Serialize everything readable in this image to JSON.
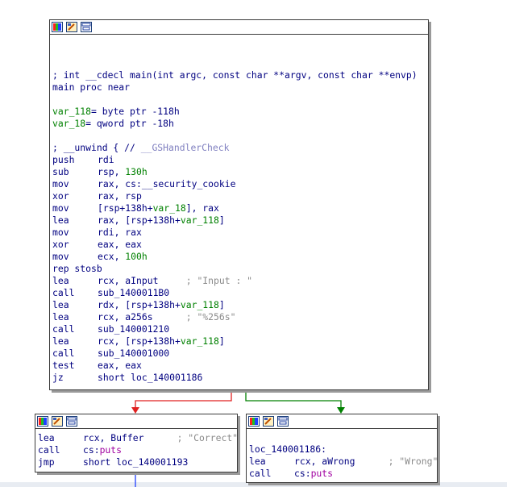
{
  "toolbar_icons": [
    "graph-color-icon",
    "edit-node-icon",
    "group-nodes-icon"
  ],
  "colors": {
    "edge_false": "#e02020",
    "edge_true": "#008000",
    "edge_uncond": "#2040ff",
    "text": "#000080",
    "number": "#008000",
    "comment": "#8a8a8a",
    "import": "#a000a0"
  },
  "main_block": {
    "header_comment": "; int __cdecl main(int argc, const char **argv, const char **envp)",
    "proc": "main proc near",
    "var1": {
      "name": "var_118",
      "def": "= byte ptr -118h"
    },
    "var2": {
      "name": "var_18",
      "def": "= qword ptr -18h"
    },
    "unwind": {
      "prefix": "; __unwind { // ",
      "handler": "__GSHandlerCheck"
    },
    "instructions": [
      {
        "mn": "push",
        "ops": "rdi"
      },
      {
        "mn": "sub",
        "ops": "rsp, ",
        "num": "130h"
      },
      {
        "mn": "mov",
        "ops": "rax, cs:__security_cookie"
      },
      {
        "mn": "xor",
        "ops": "rax, rsp"
      },
      {
        "mn": "mov",
        "pre": "[rsp+138h+",
        "var": "var_18",
        "post": "], rax"
      },
      {
        "mn": "lea",
        "pre": "rax, [rsp+138h+",
        "var": "var_118",
        "post": "]"
      },
      {
        "mn": "mov",
        "ops": "rdi, rax"
      },
      {
        "mn": "xor",
        "ops": "eax, eax"
      },
      {
        "mn": "mov",
        "ops": "ecx, ",
        "num": "100h"
      }
    ],
    "rep": "rep stosb",
    "instructions2": [
      {
        "mn": "lea",
        "ops": "rcx, aInput     ",
        "cmt": "; \"Input : \""
      },
      {
        "mn": "call",
        "ops": "sub_1400011B0"
      },
      {
        "mn": "lea",
        "pre": "rdx, [rsp+138h+",
        "var": "var_118",
        "post": "]"
      },
      {
        "mn": "lea",
        "ops": "rcx, a256s      ",
        "cmt": "; \"%256s\""
      },
      {
        "mn": "call",
        "ops": "sub_140001210"
      },
      {
        "mn": "lea",
        "pre": "rcx, [rsp+138h+",
        "var": "var_118",
        "post": "]"
      },
      {
        "mn": "call",
        "ops": "sub_140001000"
      },
      {
        "mn": "test",
        "ops": "eax, eax"
      },
      {
        "mn": "jz",
        "ops": "short loc_140001186"
      }
    ]
  },
  "correct_block": {
    "l1": {
      "mn": "lea",
      "ops": "rcx, Buffer      ",
      "cmt": "; \"Correct\""
    },
    "l2": {
      "mn": "call",
      "pre": "cs:",
      "fn": "puts"
    },
    "l3": {
      "mn": "jmp",
      "ops": "short loc_140001193"
    }
  },
  "wrong_block": {
    "label": "loc_140001186:",
    "l1": {
      "mn": "lea",
      "ops": "rcx, aWrong      ",
      "cmt": "; \"Wrong\""
    },
    "l2": {
      "mn": "call",
      "pre": "cs:",
      "fn": "puts"
    }
  }
}
